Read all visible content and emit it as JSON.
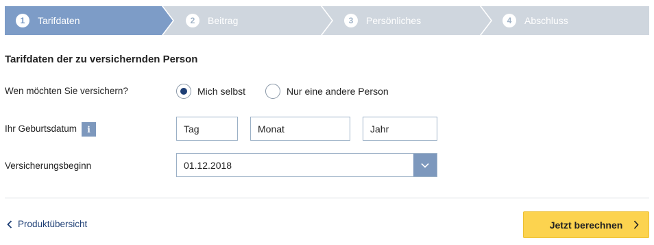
{
  "stepper": {
    "steps": [
      {
        "number": "1",
        "label": "Tarifdaten",
        "active": true
      },
      {
        "number": "2",
        "label": "Beitrag",
        "active": false
      },
      {
        "number": "3",
        "label": "Persönliches",
        "active": false
      },
      {
        "number": "4",
        "label": "Abschluss",
        "active": false
      }
    ],
    "active_color": "#7d9cc7",
    "inactive_color": "#cfd6de"
  },
  "form": {
    "title": "Tarifdaten der zu versichernden Person",
    "who_question": "Wen möchten Sie versichern?",
    "radio_options": [
      {
        "label": "Mich selbst",
        "selected": true
      },
      {
        "label": "Nur eine andere Person",
        "selected": false
      }
    ],
    "birthdate_label": "Ihr Geburtsdatum",
    "info_icon": "info-icon",
    "day_placeholder": "Tag",
    "month_placeholder": "Monat",
    "year_placeholder": "Jahr",
    "start_label": "Versicherungsbeginn",
    "start_value": "01.12.2018"
  },
  "footer": {
    "back_label": "Produktübersicht",
    "cta_label": "Jetzt berechnen",
    "cta_color": "#fcd34f"
  }
}
